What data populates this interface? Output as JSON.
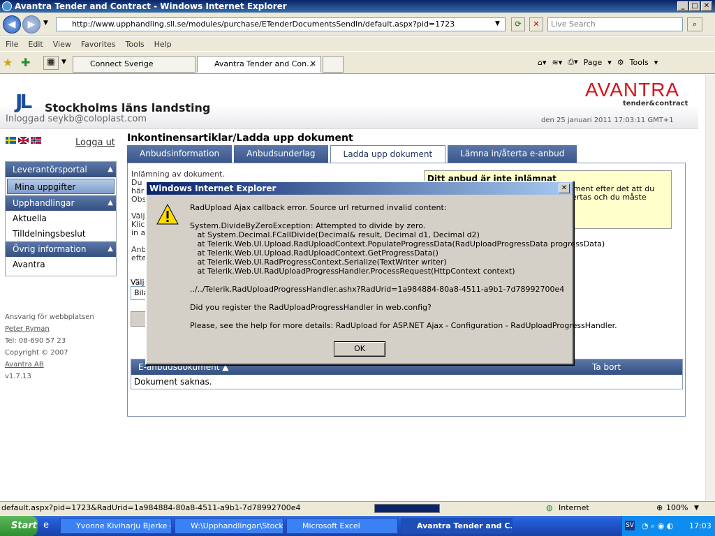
{
  "window": {
    "title": "Avantra Tender and Contract - Windows Internet Explorer",
    "min": "_",
    "max": "□",
    "close": "✕"
  },
  "browser": {
    "url": "http://www.upphandling.sll.se/modules/purchase/ETenderDocumentsSendIn/default.aspx?pid=1723",
    "search_placeholder": "Live Search",
    "menu": [
      "File",
      "Edit",
      "View",
      "Favorites",
      "Tools",
      "Help"
    ],
    "tabs": [
      "Connect Sverige",
      "Avantra Tender and Con..."
    ],
    "page_label": "Page",
    "tools_label": "Tools"
  },
  "header": {
    "org_name": "Stockholms läns landsting",
    "logged_in": "Inloggad seykb@coloplast.com",
    "brand": "AVANTRA",
    "brand_sub": "tender&contract",
    "datetime": "den 25 januari 2011 17:03:11 GMT+1"
  },
  "logout": "Logga ut",
  "sidebar": {
    "groups": [
      {
        "title": "Leverantörsportal",
        "items": [
          "Mina uppgifter"
        ]
      },
      {
        "title": "Upphandlingar",
        "items": [
          "Aktuella",
          "Tilldelningsbeslut"
        ]
      },
      {
        "title": "Övrig information",
        "items": [
          "Avantra"
        ]
      }
    ]
  },
  "footer": {
    "responsible": "Ansvarig för webbplatsen",
    "name": "Peter Ryman",
    "phone": "Tel: 08-690 57 23",
    "copyright": "Copyright © 2007",
    "company": "Avantra AB",
    "version": "v1.7.13"
  },
  "main": {
    "title": "Inkontinensartiklar/Ladda upp dokument",
    "tabs": [
      "Anbudsinformation",
      "Anbudsunderlag",
      "Ladda upp dokument",
      "Lämna in/återta e-anbud"
    ],
    "instr": [
      "Inlämning av dokument.",
      "Du",
      "här",
      "Obs",
      "",
      "Välj",
      "Klic",
      "in a",
      "",
      "Anb",
      "efte"
    ],
    "notice_title": "Ditt anbud är inte inlämnat",
    "notice_text": [
      "kument efter det att du",
      "återtas och du måste"
    ],
    "select_label": "Välj",
    "select_value": "Bila",
    "grid_col1": "E-anbudsdokument ▲",
    "grid_col2": "Ta bort",
    "grid_empty": "Dokument saknas."
  },
  "dialog": {
    "title": "Windows Internet Explorer",
    "message": "RadUpload Ajax callback error. Source url returned invalid content:\n\nSystem.DivideByZeroException: Attempted to divide by zero.\n   at System.Decimal.FCallDivide(Decimal& result, Decimal d1, Decimal d2)\n   at Telerik.Web.UI.Upload.RadUploadContext.PopulateProgressData(RadUploadProgressData progressData)\n   at Telerik.Web.UI.Upload.RadUploadContext.GetProgressData()\n   at Telerik.Web.UI.RadProgressContext.Serialize(TextWriter writer)\n   at Telerik.Web.UI.RadUploadProgressHandler.ProcessRequest(HttpContext context)\n\n../../Telerik.RadUploadProgressHandler.ashx?RadUrid=1a984884-80a8-4511-a9b1-7d78992700e4\n\nDid you register the RadUploadProgressHandler in web.config?\n\nPlease, see the help for more details: RadUpload for ASP.NET Ajax - Configuration - RadUploadProgressHandler.",
    "ok": "OK"
  },
  "status": {
    "text": "default.aspx?pid=1723&RadUrid=1a984884-80a8-4511-a9b1-7d78992700e4",
    "progress": 1.0,
    "zone": "Internet",
    "zoom": "100%"
  },
  "taskbar": {
    "start": "Start",
    "tasks": [
      "Yvonne Kiviharju Bjerke -...",
      "W:\\Upphandlingar\\Stock...",
      "Microsoft Excel",
      "Avantra Tender and C..."
    ],
    "lang": "SV",
    "clock": "17:03"
  }
}
